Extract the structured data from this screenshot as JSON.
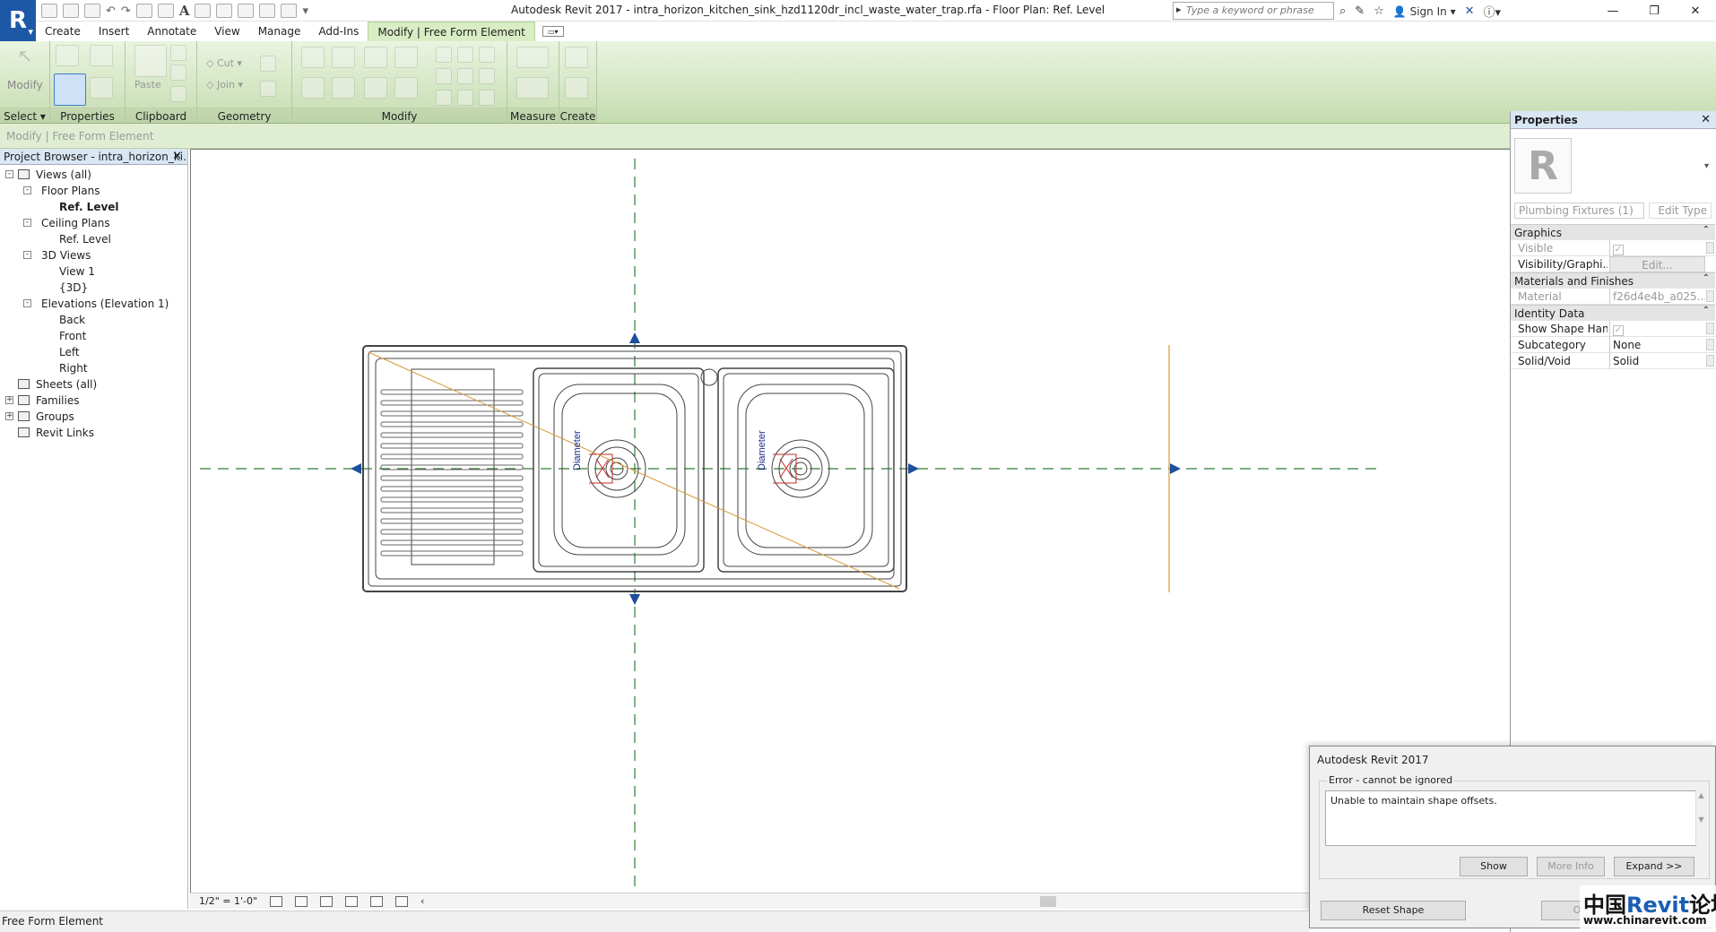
{
  "titlebar": {
    "app_logo": "R",
    "quick_access_text_icon": "A",
    "title": "Autodesk Revit 2017 -    intra_horizon_kitchen_sink_hzd1120dr_incl_waste_water_trap.rfa - Floor Plan: Ref. Level",
    "search_placeholder": "Type a keyword or phrase",
    "sign_in": "Sign In"
  },
  "ribbon": {
    "tabs": [
      "Create",
      "Insert",
      "Annotate",
      "View",
      "Manage",
      "Add-Ins",
      "Modify | Free Form Element"
    ],
    "active_tab": "Modify | Free Form Element",
    "panels": {
      "select": "Select",
      "properties": "Properties",
      "clipboard": "Clipboard",
      "geometry": "Geometry",
      "modify": "Modify",
      "measure": "Measure",
      "create": "Create"
    },
    "modify_button": "Modify",
    "paste_button": "Paste",
    "cut_button": "Cut",
    "join_button": "Join"
  },
  "context_bar": "Modify | Free Form Element",
  "project_browser": {
    "title": "Project Browser - intra_horizon_ki...",
    "tree": [
      {
        "label": "Views (all)",
        "level": 0,
        "toggle": "-",
        "bold": false
      },
      {
        "label": "Floor Plans",
        "level": 1,
        "toggle": "-",
        "bold": false
      },
      {
        "label": "Ref. Level",
        "level": 2,
        "toggle": "",
        "bold": true
      },
      {
        "label": "Ceiling Plans",
        "level": 1,
        "toggle": "-",
        "bold": false
      },
      {
        "label": "Ref. Level",
        "level": 2,
        "toggle": "",
        "bold": false
      },
      {
        "label": "3D Views",
        "level": 1,
        "toggle": "-",
        "bold": false
      },
      {
        "label": "View 1",
        "level": 2,
        "toggle": "",
        "bold": false
      },
      {
        "label": "{3D}",
        "level": 2,
        "toggle": "",
        "bold": false
      },
      {
        "label": "Elevations (Elevation 1)",
        "level": 1,
        "toggle": "-",
        "bold": false
      },
      {
        "label": "Back",
        "level": 2,
        "toggle": "",
        "bold": false
      },
      {
        "label": "Front",
        "level": 2,
        "toggle": "",
        "bold": false
      },
      {
        "label": "Left",
        "level": 2,
        "toggle": "",
        "bold": false
      },
      {
        "label": "Right",
        "level": 2,
        "toggle": "",
        "bold": false
      },
      {
        "label": "Sheets (all)",
        "level": 0,
        "toggle": "",
        "bold": false
      },
      {
        "label": "Families",
        "level": 0,
        "toggle": "+",
        "bold": false
      },
      {
        "label": "Groups",
        "level": 0,
        "toggle": "+",
        "bold": false
      },
      {
        "label": "Revit Links",
        "level": 0,
        "toggle": "",
        "bold": false
      }
    ]
  },
  "drawing": {
    "dimension_label": "Diameter"
  },
  "view_control": {
    "scale": "1/2\" = 1'-0\""
  },
  "properties": {
    "title": "Properties",
    "type_image_letter": "R",
    "type_selector": "Plumbing Fixtures (1)",
    "edit_type": "Edit Type",
    "groups": {
      "graphics": "Graphics",
      "materials": "Materials and Finishes",
      "identity": "Identity Data"
    },
    "rows": {
      "visible": {
        "name": "Visible",
        "value": "✓"
      },
      "visibility": {
        "name": "Visibility/Graphi...",
        "value": "Edit..."
      },
      "material": {
        "name": "Material",
        "value": "f26d4e4b_a025..."
      },
      "show_shape": {
        "name": "Show Shape Han...",
        "value": "✓"
      },
      "subcategory": {
        "name": "Subcategory",
        "value": "None"
      },
      "solid_void": {
        "name": "Solid/Void",
        "value": "Solid"
      }
    }
  },
  "error_dialog": {
    "title": "Autodesk Revit 2017",
    "group_label": "Error - cannot be ignored",
    "message": "Unable to maintain shape offsets.",
    "show": "Show",
    "more_info": "More Info",
    "expand": "Expand >>",
    "reset_shape": "Reset Shape",
    "ok_partial": "O"
  },
  "status_bar": "Free Form Element",
  "watermark": {
    "cn_left": "中国",
    "revit": "Revit",
    "cn_right": "论坛",
    "url": "www.chinarevit.com"
  },
  "colors": {
    "ribbon_green": "#d8edc4",
    "logo_blue": "#1c58a6",
    "reference_line": "#2e7d32",
    "control_arrow": "#1f4e9c",
    "diagonal": "#d79a3a",
    "dimension_text": "#1a2a8a"
  }
}
